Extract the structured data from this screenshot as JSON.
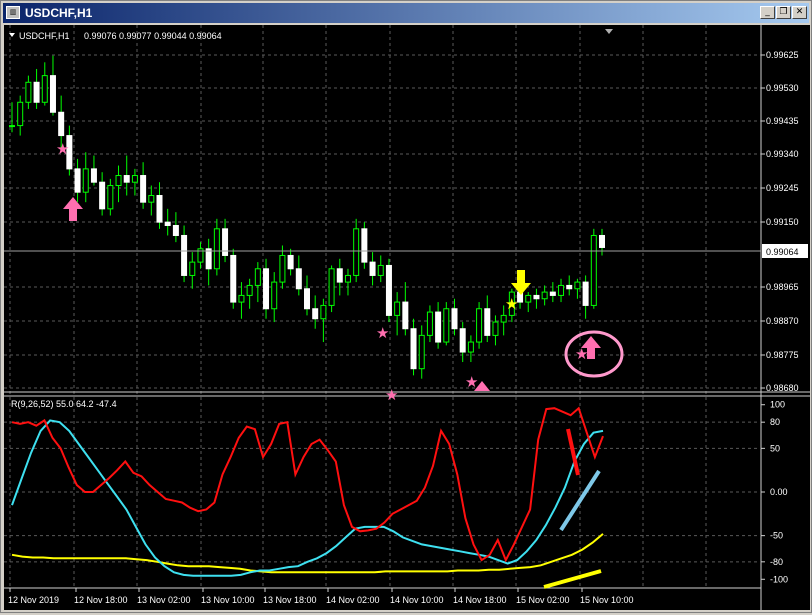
{
  "window": {
    "title": "USDCHF,H1",
    "icon": "chart-window-icon",
    "buttons": {
      "minimize": "minimize-icon",
      "restore": "restore-icon",
      "close": "close-icon"
    }
  },
  "chart": {
    "symbol_label": "USDCHF,H1",
    "ohlc_label": "0.99076 0.99077 0.99044 0.99064",
    "current_price_label": "0.99064",
    "price_axis": [
      "0.99625",
      "0.99530",
      "0.99435",
      "0.99340",
      "0.99245",
      "0.99150",
      "0.98965",
      "0.98870",
      "0.98775",
      "0.98680"
    ],
    "time_axis": [
      "12 Nov 2019",
      "12 Nov 18:00",
      "13 Nov 02:00",
      "13 Nov 10:00",
      "13 Nov 18:00",
      "14 Nov 02:00",
      "14 Nov 10:00",
      "14 Nov 18:00",
      "15 Nov 02:00",
      "15 Nov 10:00"
    ],
    "colors": {
      "background": "#000000",
      "grid": "#6e6e6e",
      "bull": "#00ff00",
      "bear": "#ffffff",
      "wick": "#00ff00"
    }
  },
  "indicator": {
    "label": "R(9,26,52) 55.0 64.2 -47.4",
    "levels": [
      "100",
      "80",
      "50",
      "0.00",
      "-50",
      "-80",
      "-100"
    ],
    "colors": {
      "fast": "#ff1010",
      "mid": "#3ee0f0",
      "slow": "#ffff00"
    }
  },
  "chart_data": {
    "type": "candlestick",
    "title": "USDCHF,H1",
    "ohlc": [
      [
        0.9943,
        0.995,
        0.9941,
        0.9943
      ],
      [
        0.9943,
        0.9952,
        0.994,
        0.995
      ],
      [
        0.995,
        0.9958,
        0.9948,
        0.9956
      ],
      [
        0.9956,
        0.996,
        0.9948,
        0.995
      ],
      [
        0.995,
        0.9962,
        0.9949,
        0.9958
      ],
      [
        0.9958,
        0.9964,
        0.9946,
        0.9947
      ],
      [
        0.9947,
        0.9952,
        0.9935,
        0.994
      ],
      [
        0.994,
        0.9943,
        0.9928,
        0.993
      ],
      [
        0.993,
        0.9933,
        0.992,
        0.9923
      ],
      [
        0.9923,
        0.9935,
        0.992,
        0.993
      ],
      [
        0.993,
        0.9934,
        0.9925,
        0.9926
      ],
      [
        0.9926,
        0.9929,
        0.9916,
        0.9918
      ],
      [
        0.9918,
        0.9927,
        0.9916,
        0.9925
      ],
      [
        0.9925,
        0.9931,
        0.992,
        0.9928
      ],
      [
        0.9928,
        0.9934,
        0.9922,
        0.9926
      ],
      [
        0.9926,
        0.993,
        0.9922,
        0.9928
      ],
      [
        0.9928,
        0.9932,
        0.9918,
        0.992
      ],
      [
        0.992,
        0.9925,
        0.9916,
        0.9922
      ],
      [
        0.9922,
        0.9926,
        0.9912,
        0.9914
      ],
      [
        0.9914,
        0.9918,
        0.991,
        0.9913
      ],
      [
        0.9913,
        0.9917,
        0.9908,
        0.991
      ],
      [
        0.991,
        0.9913,
        0.9896,
        0.9898
      ],
      [
        0.9898,
        0.9905,
        0.9894,
        0.9902
      ],
      [
        0.9902,
        0.9908,
        0.99,
        0.9906
      ],
      [
        0.9906,
        0.9909,
        0.9895,
        0.99
      ],
      [
        0.99,
        0.9915,
        0.9898,
        0.9912
      ],
      [
        0.9912,
        0.9915,
        0.9902,
        0.9904
      ],
      [
        0.9904,
        0.9906,
        0.9888,
        0.989
      ],
      [
        0.989,
        0.9896,
        0.9885,
        0.9892
      ],
      [
        0.9892,
        0.9897,
        0.9888,
        0.9895
      ],
      [
        0.9895,
        0.9902,
        0.989,
        0.99
      ],
      [
        0.99,
        0.9903,
        0.9885,
        0.9888
      ],
      [
        0.9888,
        0.9899,
        0.9884,
        0.9896
      ],
      [
        0.9896,
        0.9907,
        0.9894,
        0.9904
      ],
      [
        0.9904,
        0.9906,
        0.9898,
        0.99
      ],
      [
        0.99,
        0.9904,
        0.9892,
        0.9894
      ],
      [
        0.9894,
        0.9898,
        0.9886,
        0.9888
      ],
      [
        0.9888,
        0.9892,
        0.9882,
        0.9885
      ],
      [
        0.9885,
        0.9891,
        0.9878,
        0.9889
      ],
      [
        0.9889,
        0.9901,
        0.9887,
        0.99
      ],
      [
        0.99,
        0.9903,
        0.9892,
        0.9896
      ],
      [
        0.9896,
        0.99,
        0.9892,
        0.9898
      ],
      [
        0.9898,
        0.9915,
        0.9896,
        0.9912
      ],
      [
        0.9912,
        0.9914,
        0.99,
        0.9902
      ],
      [
        0.9902,
        0.9905,
        0.9895,
        0.9898
      ],
      [
        0.9898,
        0.9904,
        0.9896,
        0.9901
      ],
      [
        0.9901,
        0.9903,
        0.9884,
        0.9886
      ],
      [
        0.9886,
        0.9893,
        0.988,
        0.989
      ],
      [
        0.989,
        0.9896,
        0.988,
        0.9882
      ],
      [
        0.9882,
        0.9885,
        0.9868,
        0.987
      ],
      [
        0.987,
        0.9883,
        0.9867,
        0.988
      ],
      [
        0.988,
        0.9889,
        0.9878,
        0.9887
      ],
      [
        0.9887,
        0.989,
        0.9876,
        0.9878
      ],
      [
        0.9878,
        0.989,
        0.9877,
        0.9888
      ],
      [
        0.9888,
        0.9891,
        0.988,
        0.9882
      ],
      [
        0.9882,
        0.9884,
        0.9872,
        0.9875
      ],
      [
        0.9875,
        0.988,
        0.9872,
        0.9878
      ],
      [
        0.9878,
        0.989,
        0.9876,
        0.9888
      ],
      [
        0.9888,
        0.9892,
        0.9878,
        0.988
      ],
      [
        0.988,
        0.9886,
        0.9877,
        0.9884
      ],
      [
        0.9884,
        0.9889,
        0.988,
        0.9886
      ],
      [
        0.9886,
        0.9894,
        0.9884,
        0.9893
      ],
      [
        0.9893,
        0.9895,
        0.9888,
        0.989
      ],
      [
        0.989,
        0.9893,
        0.9887,
        0.9892
      ],
      [
        0.9892,
        0.9894,
        0.9888,
        0.9891
      ],
      [
        0.9891,
        0.9895,
        0.9889,
        0.9893
      ],
      [
        0.9893,
        0.9896,
        0.989,
        0.9892
      ],
      [
        0.9892,
        0.9897,
        0.989,
        0.9895
      ],
      [
        0.9895,
        0.9898,
        0.9892,
        0.9894
      ],
      [
        0.9894,
        0.9897,
        0.9891,
        0.9896
      ],
      [
        0.9896,
        0.9898,
        0.9885,
        0.9889
      ],
      [
        0.9889,
        0.9912,
        0.9888,
        0.991
      ],
      [
        0.991,
        0.9912,
        0.9904,
        0.99064
      ]
    ],
    "rsi_fast": [
      80,
      78,
      80,
      76,
      82,
      62,
      50,
      28,
      8,
      0,
      0,
      8,
      16,
      25,
      35,
      22,
      18,
      8,
      0,
      -8,
      -10,
      -12,
      -18,
      -22,
      -20,
      -12,
      20,
      40,
      62,
      75,
      72,
      40,
      55,
      78,
      80,
      20,
      40,
      55,
      60,
      48,
      35,
      -15,
      -40,
      -45,
      -44,
      -42,
      -35,
      -25,
      -20,
      -15,
      -10,
      5,
      30,
      70,
      55,
      20,
      -30,
      -60,
      -78,
      -72,
      -55,
      -78,
      -60,
      -40,
      -20,
      60,
      95,
      96,
      92,
      88,
      96,
      68,
      40,
      64
    ],
    "rsi_mid": [
      -15,
      15,
      45,
      70,
      82,
      80,
      70,
      55,
      40,
      25,
      10,
      -5,
      -20,
      -40,
      -60,
      -75,
      -85,
      -92,
      -95,
      -96,
      -96,
      -96,
      -96,
      -96,
      -95,
      -92,
      -90,
      -90,
      -88,
      -86,
      -85,
      -80,
      -76,
      -70,
      -62,
      -52,
      -42,
      -40,
      -40,
      -40,
      -45,
      -52,
      -56,
      -60,
      -62,
      -64,
      -66,
      -68,
      -70,
      -72,
      -74,
      -78,
      -82,
      -78,
      -68,
      -55,
      -38,
      -18,
      5,
      35,
      55,
      68,
      70
    ],
    "rsi_slow": [
      -72,
      -74,
      -75,
      -75,
      -76,
      -76,
      -76,
      -76,
      -76,
      -76,
      -76,
      -76,
      -77,
      -78,
      -80,
      -82,
      -84,
      -85,
      -85,
      -85,
      -86,
      -87,
      -88,
      -90,
      -91,
      -92,
      -92,
      -92,
      -92,
      -92,
      -92,
      -92,
      -92,
      -92,
      -92,
      -92,
      -91,
      -91,
      -91,
      -91,
      -91,
      -91,
      -91,
      -90,
      -90,
      -90,
      -89,
      -89,
      -88,
      -87,
      -86,
      -84,
      -80,
      -76,
      -72,
      -66,
      -58,
      -48
    ],
    "y_range": [
      0.9863,
      0.9972
    ],
    "indicator_range": [
      -110,
      110
    ]
  }
}
